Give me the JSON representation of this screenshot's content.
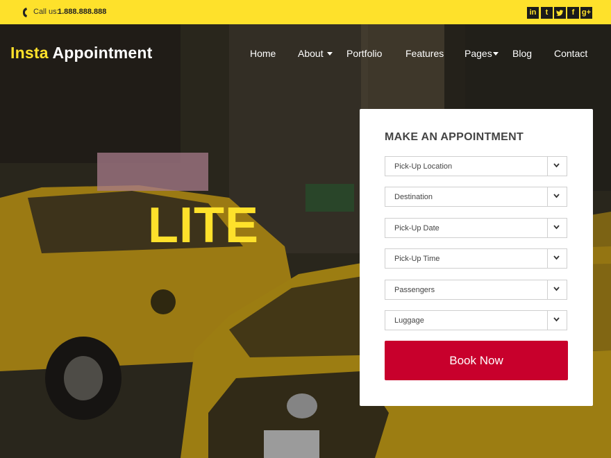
{
  "topbar": {
    "call_label": "Call us:",
    "call_number": "1.888.888.888",
    "social": [
      {
        "label": "in",
        "icon": "linkedin-icon"
      },
      {
        "label": "t",
        "icon": "tumblr-icon"
      },
      {
        "label": "🐦",
        "icon": "twitter-icon"
      },
      {
        "label": "f",
        "icon": "facebook-icon"
      },
      {
        "label": "g+",
        "icon": "google-plus-icon"
      }
    ]
  },
  "brand": {
    "part1": "Insta",
    "part2": "Appointment"
  },
  "nav": {
    "items": [
      {
        "label": "Home"
      },
      {
        "label": "About",
        "has_dropdown": true
      },
      {
        "label": "Portfolio"
      },
      {
        "label": "Features"
      },
      {
        "label": "Pages",
        "has_dropdown": true
      },
      {
        "label": "Blog"
      },
      {
        "label": "Contact"
      }
    ]
  },
  "hero": {
    "headline": "LITE"
  },
  "appointment_form": {
    "title": "MAKE AN APPOINTMENT",
    "fields": [
      {
        "label": "Pick-Up Location"
      },
      {
        "label": "Destination"
      },
      {
        "label": "Pick-Up Date"
      },
      {
        "label": "Pick-Up Time"
      },
      {
        "label": "Passengers"
      },
      {
        "label": "Luggage"
      }
    ],
    "submit_label": "Book Now"
  },
  "colors": {
    "accent_yellow": "#fee12b",
    "button_red": "#c8002c"
  }
}
